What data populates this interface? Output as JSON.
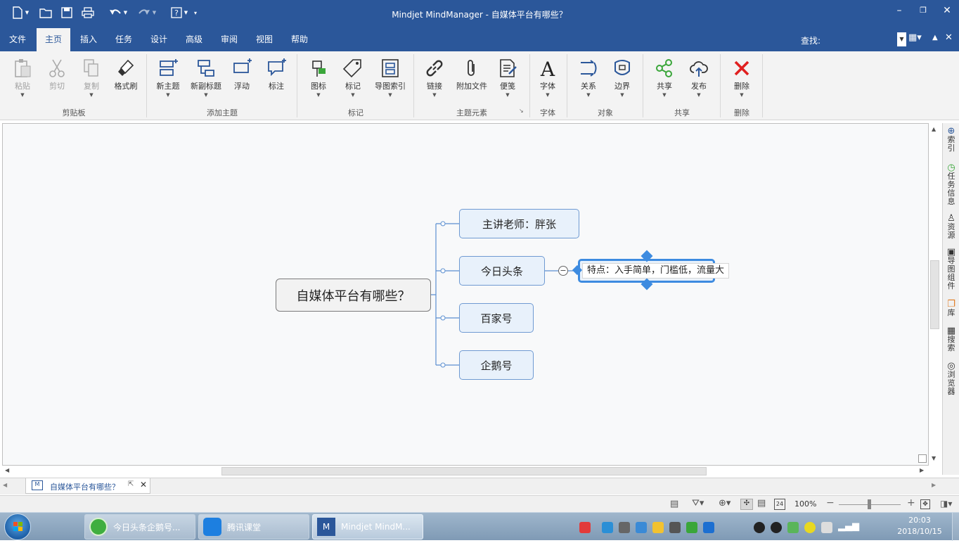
{
  "app": {
    "title": "Mindjet MindManager - 自媒体平台有哪些？",
    "find_label": "查找:"
  },
  "menu": {
    "tabs": [
      "文件",
      "主页",
      "插入",
      "任务",
      "设计",
      "高级",
      "审阅",
      "视图",
      "帮助"
    ],
    "active": "主页"
  },
  "ribbon": {
    "groups": [
      {
        "label": "剪贴板",
        "buttons": [
          "粘贴",
          "剪切",
          "复制",
          "格式刷"
        ]
      },
      {
        "label": "添加主题",
        "buttons": [
          "新主题",
          "新副标题",
          "浮动",
          "标注"
        ]
      },
      {
        "label": "标记",
        "buttons": [
          "图标",
          "标记",
          "导图索引"
        ]
      },
      {
        "label": "主题元素",
        "buttons": [
          "链接",
          "附加文件",
          "便笺"
        ]
      },
      {
        "label": "字体",
        "buttons": [
          "字体"
        ]
      },
      {
        "label": "对象",
        "buttons": [
          "关系",
          "边界"
        ]
      },
      {
        "label": "共享",
        "buttons": [
          "共享",
          "发布"
        ]
      },
      {
        "label": "删除",
        "buttons": [
          "删除"
        ]
      }
    ]
  },
  "map": {
    "central": "自媒体平台有哪些？",
    "topics": [
      "主讲老师：胖张",
      "今日头条",
      "百家号",
      "企鹅号"
    ],
    "editing_text": "特点：入手简单，门槛低，流量大"
  },
  "right_pane": {
    "items": [
      "索引",
      "任务信息",
      "资源",
      "导图组件",
      "库",
      "搜索",
      "浏览器"
    ]
  },
  "doc_tab": {
    "label": "自媒体平台有哪些？"
  },
  "status": {
    "zoom": "100%"
  },
  "taskbar": {
    "buttons": [
      "今日头条企鹅号...",
      "腾讯课堂",
      "Mindjet MindM..."
    ],
    "time": "20:03",
    "date": "2018/10/15"
  },
  "colors": {
    "titlebar": "#2b579a",
    "topic_fill": "#e8f1fb",
    "topic_border": "#6f9ad2",
    "branch_line": "#5b8fd0",
    "delete_red": "#e02020"
  }
}
